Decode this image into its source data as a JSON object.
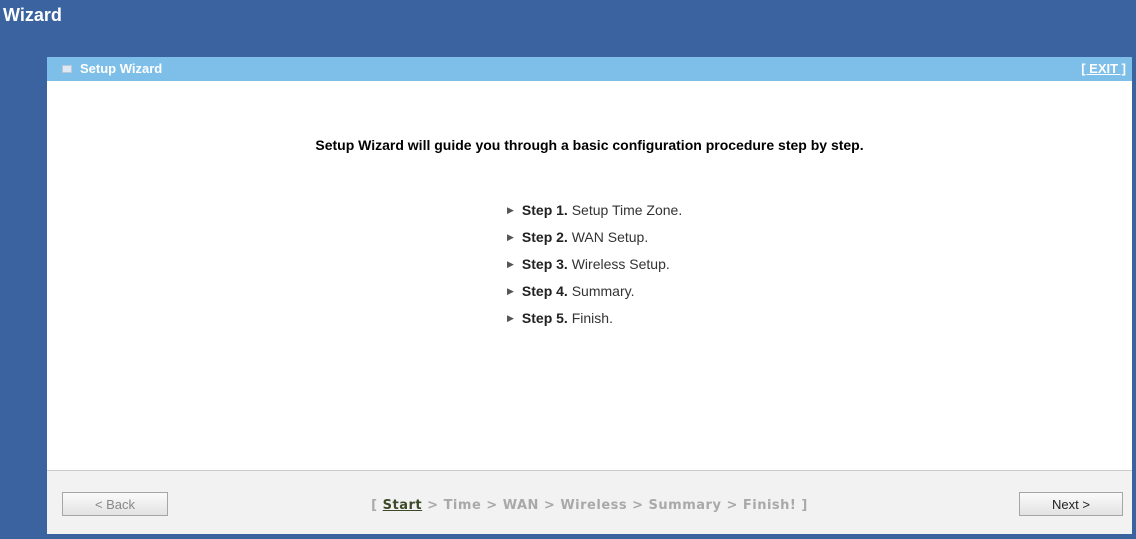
{
  "window": {
    "title": "Wizard"
  },
  "panel": {
    "title": "Setup Wizard",
    "exit_label": "[ EXIT ]",
    "intro": "Setup Wizard will guide you through a basic configuration procedure step by step."
  },
  "steps": [
    {
      "label": "Step 1.",
      "text": " Setup Time Zone."
    },
    {
      "label": "Step 2.",
      "text": " WAN Setup."
    },
    {
      "label": "Step 3.",
      "text": " Wireless Setup."
    },
    {
      "label": "Step 4.",
      "text": " Summary."
    },
    {
      "label": "Step 5.",
      "text": " Finish."
    }
  ],
  "footer": {
    "back_label": "< Back",
    "next_label": "Next >",
    "progress": {
      "open": "[ ",
      "current": "Start",
      "rest": " > Time > WAN > Wireless > Summary > Finish! ]"
    }
  },
  "colors": {
    "frame": "#3a63a0",
    "header": "#7dbfe9",
    "footer": "#f2f2f2"
  },
  "icons": {
    "panel_header": "panel-icon",
    "step_bullet": "triangle-right-icon"
  }
}
